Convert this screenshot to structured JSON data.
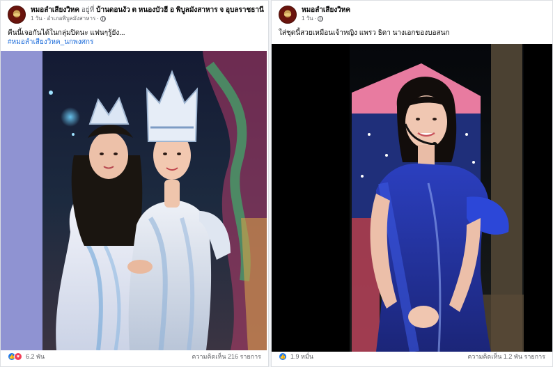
{
  "post1": {
    "page_name": "หมอลำเสียงวิหค",
    "location_prefix": "อยู่ที่",
    "location": "บ้านดอนงัว ต หนองบัวฮี อ พิบูลมังสาหาร จ อุบลราชธานี",
    "time": "1 วัน",
    "sub_location": "อำเภอพิบูลมังสาหาร",
    "caption": "คืนนี้เจอกันได้ในกลุ่มปิดนะ แฟนๆรู้ยัง...",
    "hashtag": "#หมอลำเสียงวิหค_นกพงศกร",
    "reaction_count": "6.2 พัน",
    "comments": "ความคิดเห็น 216 รายการ"
  },
  "post2": {
    "page_name": "หมอลำเสียงวิหค",
    "time": "1 วัน",
    "caption": "ใส่ชุดนี้สวยเหมือนเจ้าหญิง แพรว ธิดา นางเอกของบอสนก",
    "reaction_count": "1.9 หมื่น",
    "comments": "ความคิดเห็น 1.2 พัน รายการ"
  },
  "colors": {
    "accent_blue": "#1877f2",
    "love_red": "#f33e58",
    "muted_text": "#65676b"
  },
  "icons": [
    "globe-icon",
    "like-reaction-icon",
    "love-reaction-icon"
  ]
}
